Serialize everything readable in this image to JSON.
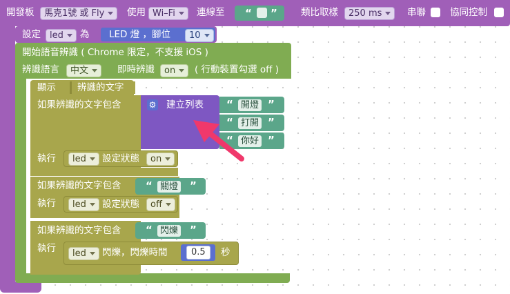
{
  "board": {
    "label": "開發板",
    "board_value": "馬克1號 或 Fly",
    "use_label": "使用",
    "conn_value": "Wi–Fi",
    "connect_to_label": "連線至",
    "quote_open": "“",
    "quote_close": "”",
    "sample_label": "類比取樣",
    "sample_value": "250 ms",
    "serial_label": "串聯",
    "coop_label": "協同控制"
  },
  "set_led": {
    "set_label": "設定",
    "var_value": "led",
    "as_label": "為",
    "led_label": "LED 燈 ，腳位",
    "pin_value": "10"
  },
  "speech": {
    "start_label": "開始語音辨識 ( Chrome 限定，不支援 iOS )",
    "lang_label": "辨識語言",
    "lang_value": "中文",
    "instant_label": "即時辨識",
    "instant_value": "on",
    "mobile_note": "( 行動裝置勾選 off )"
  },
  "show": {
    "label": "顯示",
    "value": "辨識的文字"
  },
  "if_blocks": [
    {
      "cond_label": "如果辨識的文字包含",
      "do_label": "執行",
      "list_label": "建立列表",
      "items": [
        "開燈",
        "打開",
        "你好"
      ],
      "led_value": "led",
      "action_label": "設定狀態",
      "state_value": "on"
    },
    {
      "cond_label": "如果辨識的文字包含",
      "do_label": "執行",
      "text": "關燈",
      "led_value": "led",
      "action_label": "設定狀態",
      "state_value": "off"
    },
    {
      "cond_label": "如果辨識的文字包含",
      "do_label": "執行",
      "text": "閃爍",
      "led_value": "led",
      "action_label": "閃爍，閃爍時間",
      "time_value": "0.5",
      "unit_label": "秒"
    }
  ],
  "colors": {
    "purple": "#a05fb8",
    "green": "#80ac52",
    "olive": "#a8a64c",
    "teal": "#5ba68a",
    "blue": "#5b6fcf",
    "list_purple": "#7e57c2",
    "arrow": "#f0386b"
  }
}
